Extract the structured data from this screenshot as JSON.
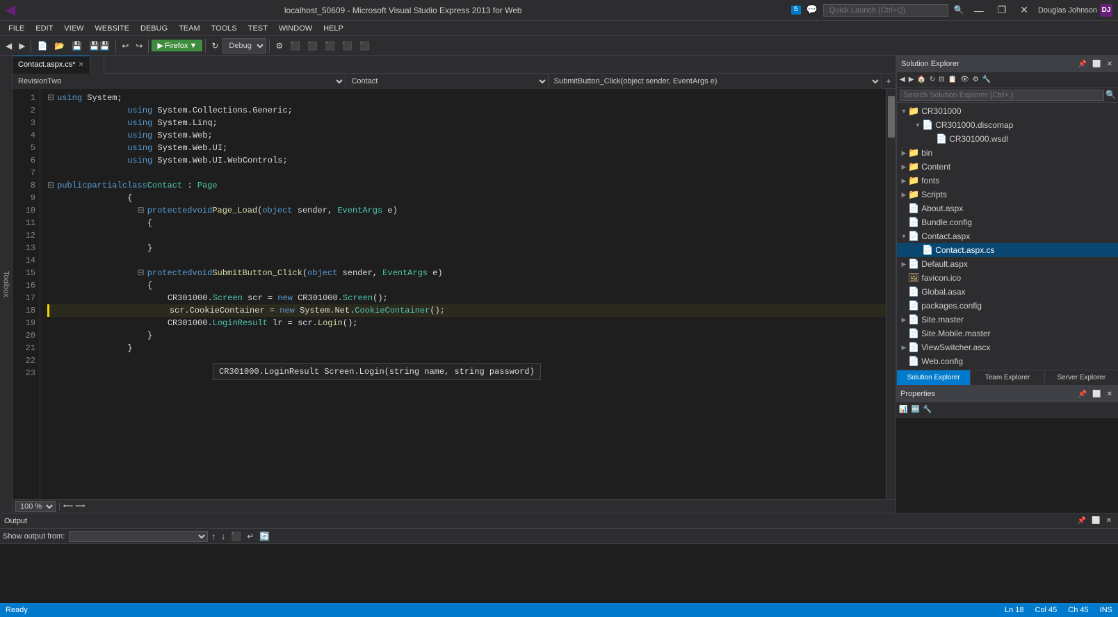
{
  "titleBar": {
    "title": "localhost_50609 - Microsoft Visual Studio Express 2013 for Web",
    "logo": "▶",
    "quickLaunch": "Quick Launch (Ctrl+Q)",
    "notifCount": "5",
    "user": "Douglas Johnson",
    "userInitials": "DJ"
  },
  "menuBar": {
    "items": [
      "FILE",
      "EDIT",
      "VIEW",
      "WEBSITE",
      "DEBUG",
      "TEAM",
      "TOOLS",
      "TEST",
      "WINDOW",
      "HELP"
    ]
  },
  "toolbar": {
    "debugMode": "Debug",
    "browser": "Firefox"
  },
  "tabs": [
    {
      "label": "Contact.aspx.cs",
      "active": true,
      "modified": true
    },
    {
      "label": "",
      "active": false
    }
  ],
  "navBar": {
    "left": "RevisionTwo",
    "middle": "Contact",
    "right": "SubmitButton_Click(object sender, EventArgs e)"
  },
  "code": {
    "lines": [
      {
        "num": "",
        "text": "    using System;"
      },
      {
        "num": "",
        "text": "    using System.Collections.Generic;"
      },
      {
        "num": "",
        "text": "    using System.Linq;"
      },
      {
        "num": "",
        "text": "    using System.Web;"
      },
      {
        "num": "",
        "text": "    using System.Web.UI;"
      },
      {
        "num": "",
        "text": "    using System.Web.UI.WebControls;"
      },
      {
        "num": "",
        "text": ""
      },
      {
        "num": "",
        "text": "public partial class Contact : Page"
      },
      {
        "num": "",
        "text": "    {"
      },
      {
        "num": "",
        "text": "        protected void Page_Load(object sender, EventArgs e)"
      },
      {
        "num": "",
        "text": "        {"
      },
      {
        "num": "",
        "text": ""
      },
      {
        "num": "",
        "text": "        }"
      },
      {
        "num": "",
        "text": ""
      },
      {
        "num": "",
        "text": "        protected void SubmitButton_Click(object sender, EventArgs e)"
      },
      {
        "num": "",
        "text": "        {"
      },
      {
        "num": "",
        "text": "            CR301000.Screen scr = new CR301000.Screen();"
      },
      {
        "num": "",
        "text": "            scr.CookieContainer = new System.Net.CookieContainer();"
      },
      {
        "num": "",
        "text": "            CR301000.LoginResult lr = scr.Login();"
      },
      {
        "num": "",
        "text": "        }"
      },
      {
        "num": "",
        "text": "    }"
      }
    ],
    "tooltip": "CR301000.LoginResult Screen.Login(string name, string password)"
  },
  "zoomBar": {
    "zoom": "100 %"
  },
  "solutionExplorer": {
    "title": "Solution Explorer",
    "searchPlaceholder": "Search Solution Explorer (Ctrl+;)",
    "tree": [
      {
        "indent": 0,
        "expanded": true,
        "icon": "folder",
        "label": "CR301000",
        "type": "folder"
      },
      {
        "indent": 1,
        "expanded": false,
        "icon": "file",
        "label": "CR301000.discomap",
        "type": "file-config"
      },
      {
        "indent": 2,
        "expanded": false,
        "icon": "file",
        "label": "CR301000.wsdl",
        "type": "file-config"
      },
      {
        "indent": 0,
        "expanded": false,
        "icon": "folder",
        "label": "bin",
        "type": "folder"
      },
      {
        "indent": 0,
        "expanded": false,
        "icon": "folder",
        "label": "Content",
        "type": "folder"
      },
      {
        "indent": 0,
        "expanded": false,
        "icon": "folder",
        "label": "fonts",
        "type": "folder"
      },
      {
        "indent": 0,
        "expanded": false,
        "icon": "folder",
        "label": "Scripts",
        "type": "folder"
      },
      {
        "indent": 0,
        "expanded": false,
        "icon": "file-aspx",
        "label": "About.aspx",
        "type": "file-aspx"
      },
      {
        "indent": 0,
        "expanded": false,
        "icon": "file-config",
        "label": "Bundle.config",
        "type": "file-config"
      },
      {
        "indent": 0,
        "expanded": true,
        "icon": "file-aspx",
        "label": "Contact.aspx",
        "type": "file-aspx",
        "selected": false
      },
      {
        "indent": 1,
        "expanded": false,
        "icon": "file-cs",
        "label": "Contact.aspx.cs",
        "type": "file-cs",
        "selected": true
      },
      {
        "indent": 0,
        "expanded": false,
        "icon": "file-aspx",
        "label": "Default.aspx",
        "type": "file-aspx"
      },
      {
        "indent": 0,
        "expanded": false,
        "icon": "file-ico",
        "label": "favicon.ico",
        "type": "file-ico"
      },
      {
        "indent": 0,
        "expanded": false,
        "icon": "file-config",
        "label": "Global.asax",
        "type": "file-config"
      },
      {
        "indent": 0,
        "expanded": false,
        "icon": "file-config",
        "label": "packages.config",
        "type": "file-config"
      },
      {
        "indent": 0,
        "expanded": false,
        "icon": "file-master",
        "label": "Site.master",
        "type": "file-master"
      },
      {
        "indent": 0,
        "expanded": false,
        "icon": "file-master",
        "label": "Site.Mobile.master",
        "type": "file-master"
      },
      {
        "indent": 0,
        "expanded": false,
        "icon": "file-aspx",
        "label": "ViewSwitcher.ascx",
        "type": "file-aspx"
      },
      {
        "indent": 0,
        "expanded": false,
        "icon": "folder",
        "label": "Web.config",
        "type": "file-config"
      }
    ],
    "tabs": [
      "Solution Explorer",
      "Team Explorer",
      "Server Explorer"
    ]
  },
  "properties": {
    "title": "Properties"
  },
  "output": {
    "title": "Output",
    "showOutputFrom": "Show output from:",
    "source": ""
  },
  "statusBar": {
    "status": "Ready",
    "ln": "Ln 18",
    "col": "Col 45",
    "ch": "Ch 45",
    "ins": "INS"
  },
  "toolbox": {
    "label": "Toolbox"
  }
}
